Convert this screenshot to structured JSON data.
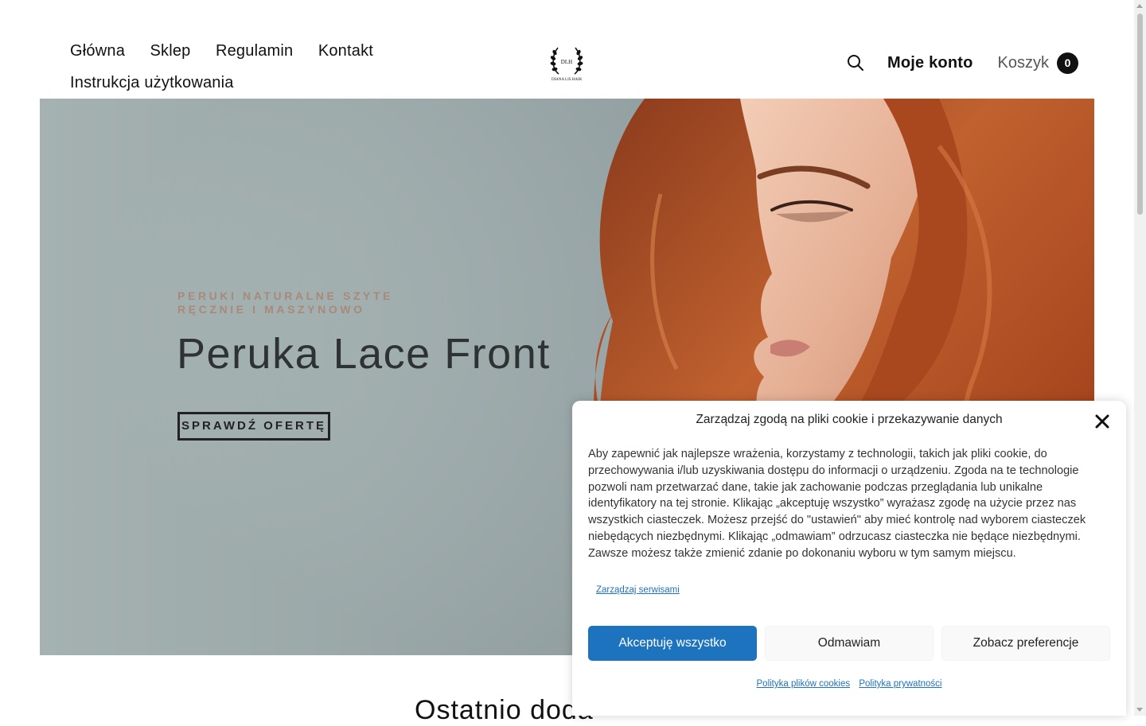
{
  "nav": {
    "items": [
      {
        "label": "Główna"
      },
      {
        "label": "Sklep"
      },
      {
        "label": "Regulamin"
      },
      {
        "label": "Kontakt"
      },
      {
        "label": "Instrukcja użytkowania"
      }
    ]
  },
  "logo": {
    "monogram": "DLH",
    "brand": "DIANA LIS HAIR"
  },
  "header": {
    "account_label": "Moje konto",
    "cart_label": "Koszyk",
    "cart_count": "0"
  },
  "hero": {
    "kicker": "PERUKI NATURALNE SZYTE RĘCZNIE I MASZYNOWO",
    "title": "Peruka Lace Front",
    "button_label": "SPRAWDŹ OFERTĘ"
  },
  "section": {
    "heading": "Ostatnio doda"
  },
  "cookie": {
    "title": "Zarządzaj zgodą na pliki cookie i przekazywanie danych",
    "body": "Aby zapewnić jak najlepsze wrażenia, korzystamy z technologii, takich jak pliki cookie, do przechowywania i/lub uzyskiwania dostępu do informacji o urządzeniu. Zgoda na te technologie pozwoli nam przetwarzać dane, takie jak zachowanie podczas przeglądania lub unikalne identyfikatory na tej stronie. Klikając „akceptuję wszystko” wyrażasz zgodę na użycie przez nas wszystkich ciasteczek. Możesz przejść do \"ustawień\" aby mieć kontrolę nad wyborem ciasteczek niebędących niezbędnymi. Klikając „odmawiam” odrzucasz ciasteczka nie będące niezbędnymi. Zawsze możesz także zmienić zdanie po dokonaniu wyboru w tym samym miejscu.",
    "manage_link": "Zarządzaj serwisami",
    "accept_label": "Akceptuję wszystko",
    "deny_label": "Odmawiam",
    "prefs_label": "Zobacz preferencje",
    "cookie_policy_link": "Polityka plików cookies",
    "privacy_policy_link": "Polityka prywatności"
  },
  "colors": {
    "accent": "#1e73be",
    "kicker": "#a8897a",
    "hair": "#b5522a"
  }
}
